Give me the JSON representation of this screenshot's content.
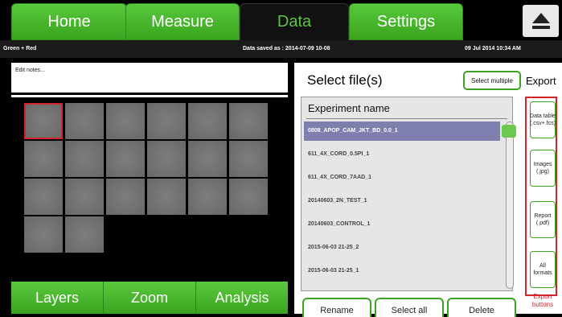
{
  "tabs": [
    {
      "label": "Home"
    },
    {
      "label": "Measure"
    },
    {
      "label": "Data",
      "active": true
    },
    {
      "label": "Settings"
    }
  ],
  "status": {
    "left": "Green + Red",
    "center": "Data saved as : 2014-07-09 10-08",
    "right": "09 Jul 2014  10:34 AM"
  },
  "notes": {
    "placeholder": "Edit notes..."
  },
  "thumbnails": {
    "count": 20,
    "selected_index": 0
  },
  "left_buttons": {
    "layers": "Layers",
    "zoom": "Zoom",
    "analysis": "Analysis"
  },
  "file_panel": {
    "title": "Select file(s)",
    "select_multiple": "Select multiple",
    "export_label": "Export",
    "column_header": "Experiment name",
    "files": [
      "0808_APOP_CAM_JKT_BD_0.0_1",
      "611_4X_CORD_0.5PI_1",
      "611_4X_CORD_7AAD_1",
      "20140603_2N_TEST_1",
      "20140603_CONTROL_1",
      "2015-06-03 21-25_2",
      "2015-06-03 21-25_1"
    ],
    "selected_index": 0
  },
  "export_buttons": {
    "data_table": "Data table (.csv+.fcs)",
    "images": "Images (.jpg)",
    "report": "Report (.pdf)",
    "all": "All formats",
    "note": "Export buttons"
  },
  "actions": {
    "rename": "Rename",
    "select_all": "Select all",
    "delete": "Delete"
  },
  "colors": {
    "accent": "#3aa31f",
    "highlight": "#7e7fad",
    "annotation": "#d3252b"
  }
}
